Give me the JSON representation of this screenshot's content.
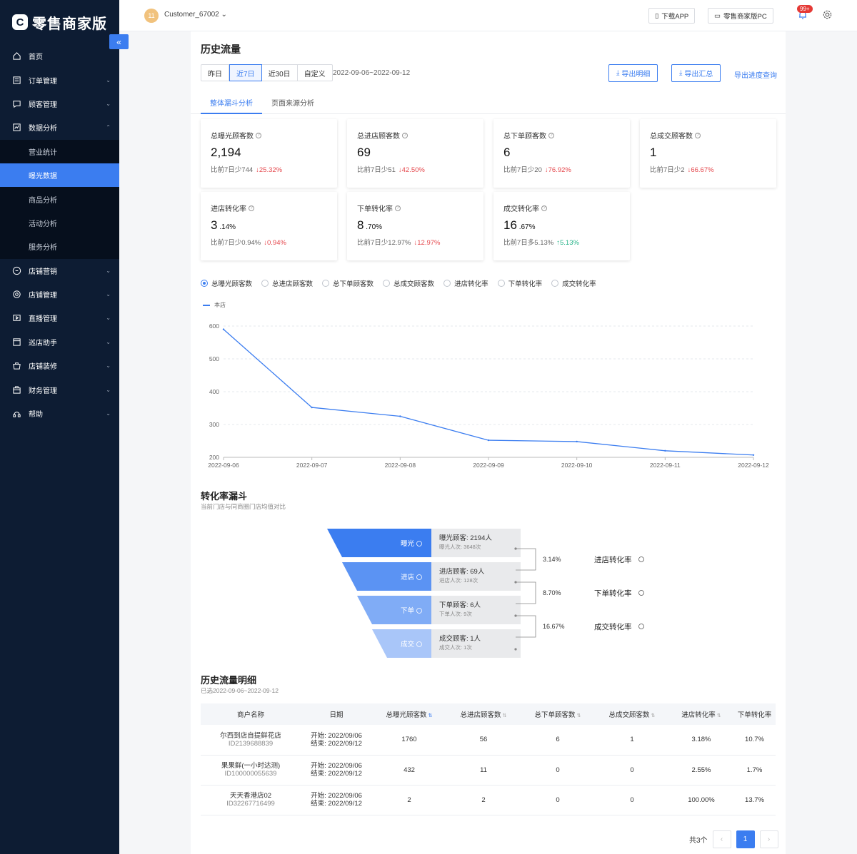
{
  "brand": {
    "logo_mark": "C",
    "title": "零售商家版"
  },
  "sidebar": {
    "items": [
      {
        "label": "首页",
        "icon": "home-icon"
      },
      {
        "label": "订单管理",
        "icon": "order-icon"
      },
      {
        "label": "顾客管理",
        "icon": "customer-icon"
      },
      {
        "label": "数据分析",
        "icon": "data-icon",
        "expanded": true
      }
    ],
    "sub_items": [
      "营业统计",
      "曝光数据",
      "商品分析",
      "活动分析",
      "服务分析"
    ],
    "active_sub": "曝光数据",
    "items_after": [
      {
        "label": "店铺营销",
        "icon": "marketing-icon"
      },
      {
        "label": "店铺管理",
        "icon": "shop-settings-icon"
      },
      {
        "label": "直播管理",
        "icon": "live-icon"
      },
      {
        "label": "巡店助手",
        "icon": "patrol-icon"
      },
      {
        "label": "店铺装修",
        "icon": "decor-icon"
      },
      {
        "label": "财务管理",
        "icon": "finance-icon"
      },
      {
        "label": "帮助",
        "icon": "help-icon"
      }
    ]
  },
  "header": {
    "avatar_text": "11",
    "user": "Customer_67002",
    "download_app": "下载APP",
    "pc_version": "零售商家版PC",
    "notification_badge": "99+"
  },
  "page": {
    "title": "历史流量",
    "ranges": [
      "昨日",
      "近7日",
      "近30日",
      "自定义"
    ],
    "active_range": "近7日",
    "date_range": "2022-09-06~2022-09-12",
    "export_detail": "导出明细",
    "export_summary": "导出汇总",
    "export_progress": "导出进度查询",
    "tabs": [
      "整体漏斗分析",
      "页面来源分析"
    ]
  },
  "cards": [
    {
      "label": "总曝光顾客数",
      "value": "2,194",
      "value_small": "",
      "compare": "比前7日少744",
      "delta": "↓25.32%",
      "dir": "down"
    },
    {
      "label": "总进店顾客数",
      "value": "69",
      "value_small": "",
      "compare": "比前7日少51",
      "delta": "↓42.50%",
      "dir": "down"
    },
    {
      "label": "总下单顾客数",
      "value": "6",
      "value_small": "",
      "compare": "比前7日少20",
      "delta": "↓76.92%",
      "dir": "down"
    },
    {
      "label": "总成交顾客数",
      "value": "1",
      "value_small": "",
      "compare": "比前7日少2",
      "delta": "↓66.67%",
      "dir": "down"
    },
    {
      "label": "进店转化率",
      "value": "3",
      "value_small": ".14%",
      "compare": "比前7日少0.94%",
      "delta": "↓0.94%",
      "dir": "down"
    },
    {
      "label": "下单转化率",
      "value": "8",
      "value_small": ".70%",
      "compare": "比前7日少12.97%",
      "delta": "↓12.97%",
      "dir": "down"
    },
    {
      "label": "成交转化率",
      "value": "16",
      "value_small": ".67%",
      "compare": "比前7日多5.13%",
      "delta": "↑5.13%",
      "dir": "up"
    }
  ],
  "metric_options": [
    "总曝光顾客数",
    "总进店顾客数",
    "总下单顾客数",
    "总成交顾客数",
    "进店转化率",
    "下单转化率",
    "成交转化率"
  ],
  "selected_metric": "总曝光顾客数",
  "colors": {
    "accent": "#3b7df0",
    "down": "#e5484d",
    "up": "#29b48a",
    "sidebar": "#0d1c33"
  },
  "chart_data": {
    "type": "line",
    "x": [
      "2022-09-06",
      "2022-09-07",
      "2022-09-08",
      "2022-09-09",
      "2022-09-10",
      "2022-09-11",
      "2022-09-12"
    ],
    "series": [
      {
        "name": "本店",
        "values": [
          590,
          352,
          325,
          252,
          248,
          220,
          207
        ]
      }
    ],
    "yticks": [
      200,
      300,
      400,
      500,
      600
    ],
    "ylim": [
      200,
      600
    ],
    "grid": true,
    "legend": "top-left"
  },
  "funnel": {
    "title": "转化率漏斗",
    "subtitle": "当前门店与同商圈门店均值对比",
    "stages": [
      {
        "name": "曝光",
        "main": "曝光顾客: 2194人",
        "sub": "曝光人次: 3648次"
      },
      {
        "name": "进店",
        "main": "进店顾客: 69人",
        "sub": "进店人次: 128次"
      },
      {
        "name": "下单",
        "main": "下单顾客: 6人",
        "sub": "下单人次: 9次"
      },
      {
        "name": "成交",
        "main": "成交顾客: 1人",
        "sub": "成交人次: 1次"
      }
    ],
    "rates": [
      {
        "value": "3.14%",
        "label": "进店转化率"
      },
      {
        "value": "8.70%",
        "label": "下单转化率"
      },
      {
        "value": "16.67%",
        "label": "成交转化率"
      }
    ]
  },
  "detail": {
    "title": "历史流量明细",
    "subtitle": "已选2022-09-06~2022-09-12",
    "columns": [
      "商户名称",
      "日期",
      "总曝光顾客数",
      "总进店顾客数",
      "总下单顾客数",
      "总成交顾客数",
      "进店转化率",
      "下单转化率"
    ],
    "rows": [
      {
        "name": "尔西到店自提鲜花店",
        "id": "ID2139688839",
        "start": "开始: 2022/09/06",
        "end": "结束: 2022/09/12",
        "exposure": "1760",
        "enter": "56",
        "order": "6",
        "deal": "1",
        "enter_rate": "3.18%",
        "order_rate": "10.7%"
      },
      {
        "name": "果果鲜(一小时达测)",
        "id": "ID100000055639",
        "start": "开始: 2022/09/06",
        "end": "结束: 2022/09/12",
        "exposure": "432",
        "enter": "11",
        "order": "0",
        "deal": "0",
        "enter_rate": "2.55%",
        "order_rate": "1.7%"
      },
      {
        "name": "天天香港店02",
        "id": "ID32267716499",
        "start": "开始: 2022/09/06",
        "end": "结束: 2022/09/12",
        "exposure": "2",
        "enter": "2",
        "order": "0",
        "deal": "0",
        "enter_rate": "100.00%",
        "order_rate": "13.7%"
      }
    ],
    "total": "共3个",
    "page": "1"
  }
}
